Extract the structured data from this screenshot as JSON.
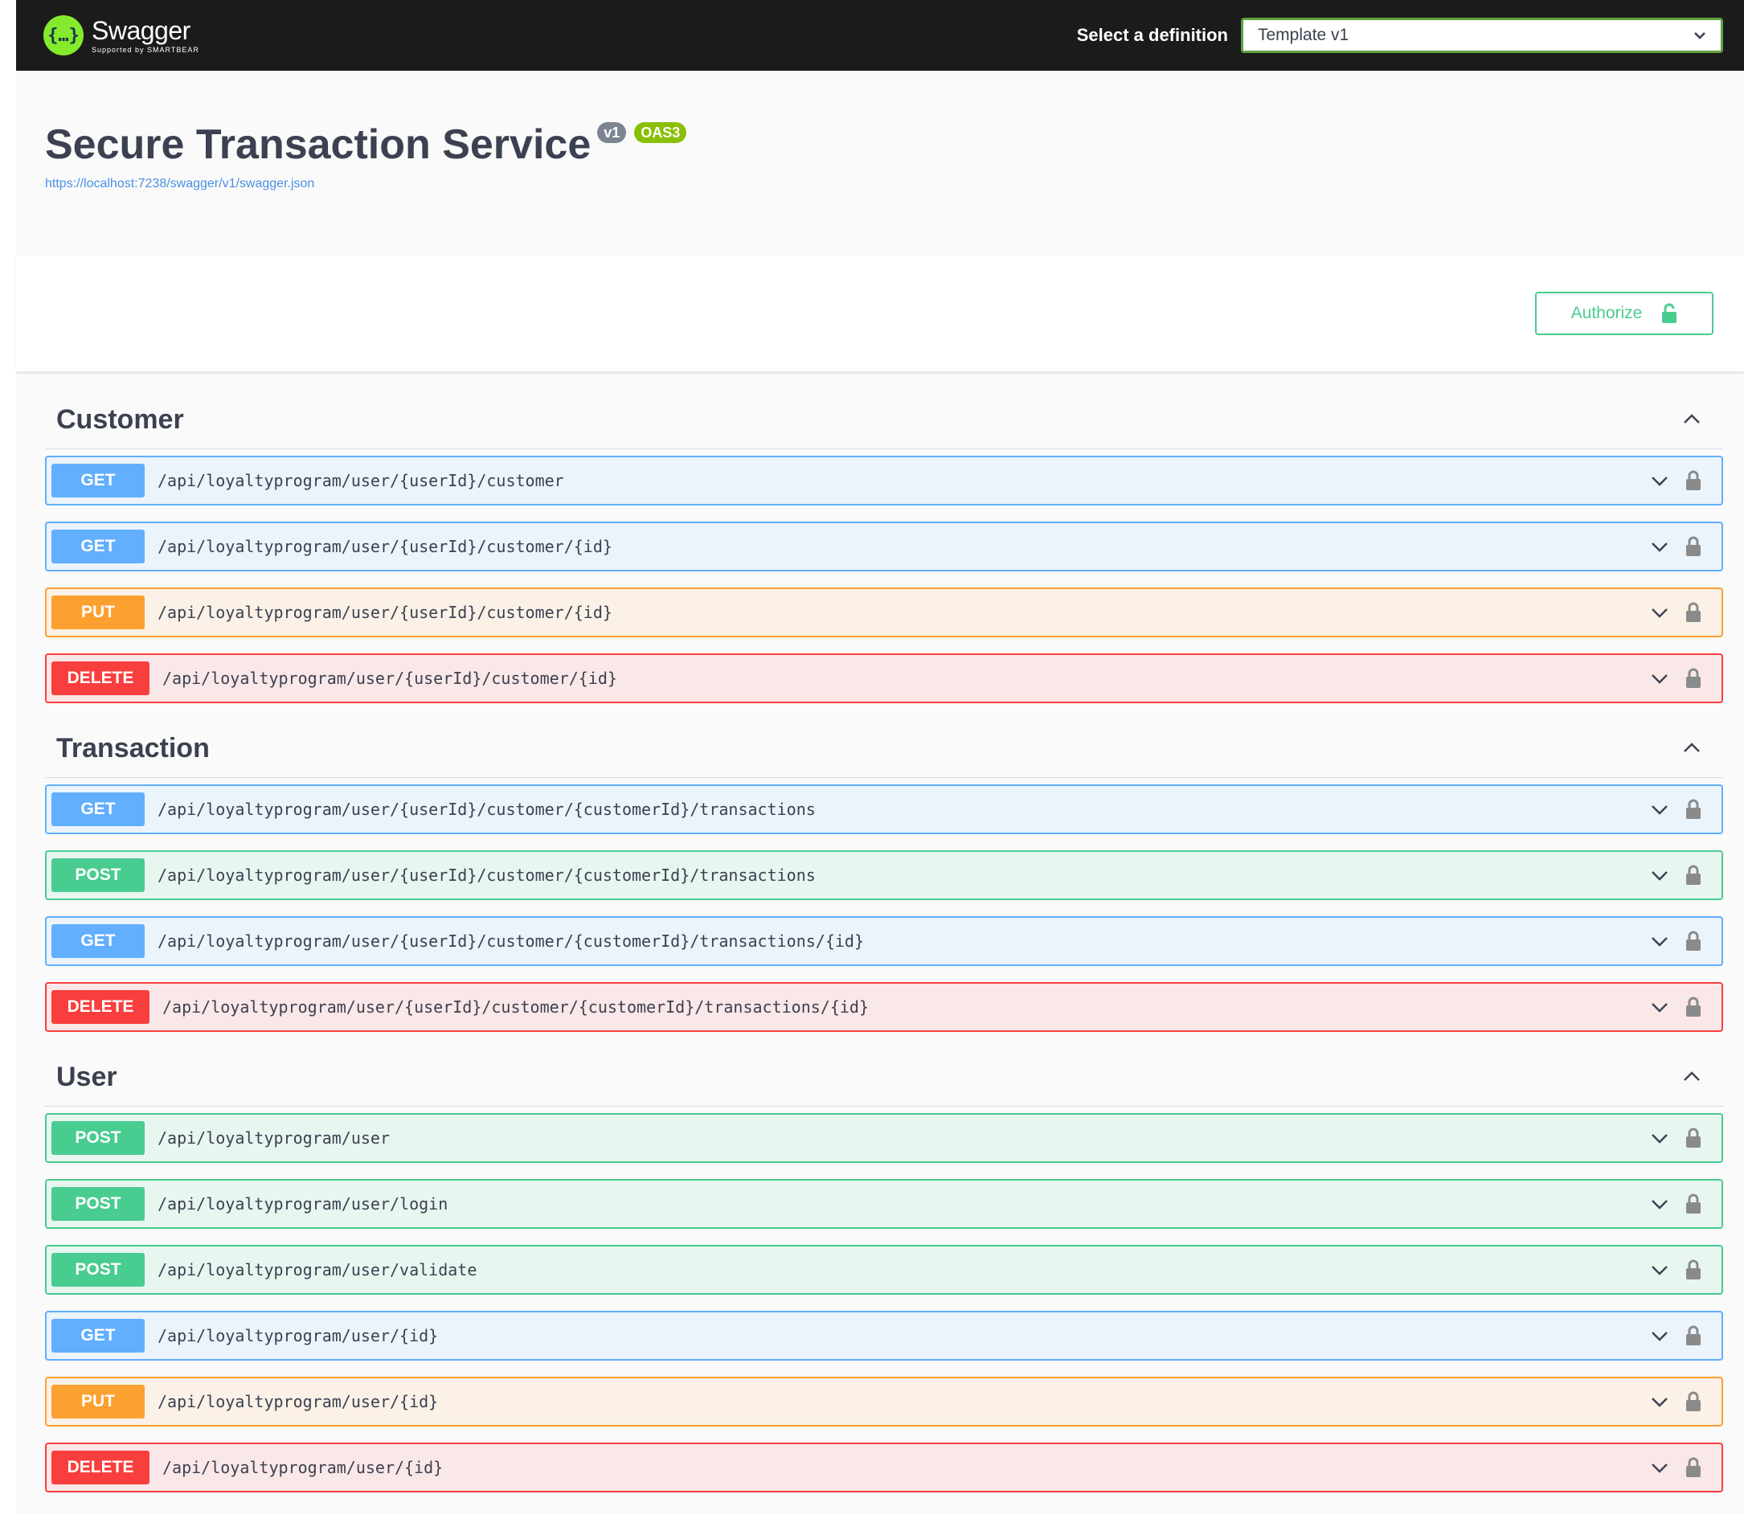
{
  "topbar": {
    "logo_name": "Swagger",
    "logo_sub": "Supported by SMARTBEAR",
    "definition_label": "Select a definition",
    "definition_value": "Template v1",
    "accent": "#85ea2d"
  },
  "info": {
    "title": "Secure Transaction Service",
    "version_badge": "v1",
    "oas_badge": "OAS3",
    "spec_url": "https://localhost:7238/swagger/v1/swagger.json"
  },
  "authorize": {
    "label": "Authorize",
    "icon": "unlock-icon"
  },
  "tags": [
    {
      "name": "Customer",
      "operations": [
        {
          "method": "GET",
          "path": "/api/loyaltyprogram/user/{userId}/customer"
        },
        {
          "method": "GET",
          "path": "/api/loyaltyprogram/user/{userId}/customer/{id}"
        },
        {
          "method": "PUT",
          "path": "/api/loyaltyprogram/user/{userId}/customer/{id}"
        },
        {
          "method": "DELETE",
          "path": "/api/loyaltyprogram/user/{userId}/customer/{id}"
        }
      ]
    },
    {
      "name": "Transaction",
      "operations": [
        {
          "method": "GET",
          "path": "/api/loyaltyprogram/user/{userId}/customer/{customerId}/transactions"
        },
        {
          "method": "POST",
          "path": "/api/loyaltyprogram/user/{userId}/customer/{customerId}/transactions"
        },
        {
          "method": "GET",
          "path": "/api/loyaltyprogram/user/{userId}/customer/{customerId}/transactions/{id}"
        },
        {
          "method": "DELETE",
          "path": "/api/loyaltyprogram/user/{userId}/customer/{customerId}/transactions/{id}"
        }
      ]
    },
    {
      "name": "User",
      "operations": [
        {
          "method": "POST",
          "path": "/api/loyaltyprogram/user"
        },
        {
          "method": "POST",
          "path": "/api/loyaltyprogram/user/login"
        },
        {
          "method": "POST",
          "path": "/api/loyaltyprogram/user/validate"
        },
        {
          "method": "GET",
          "path": "/api/loyaltyprogram/user/{id}"
        },
        {
          "method": "PUT",
          "path": "/api/loyaltyprogram/user/{id}"
        },
        {
          "method": "DELETE",
          "path": "/api/loyaltyprogram/user/{id}"
        }
      ]
    }
  ],
  "method_colors": {
    "GET": "#61affe",
    "POST": "#49cc90",
    "PUT": "#fca130",
    "DELETE": "#f93e3e"
  }
}
